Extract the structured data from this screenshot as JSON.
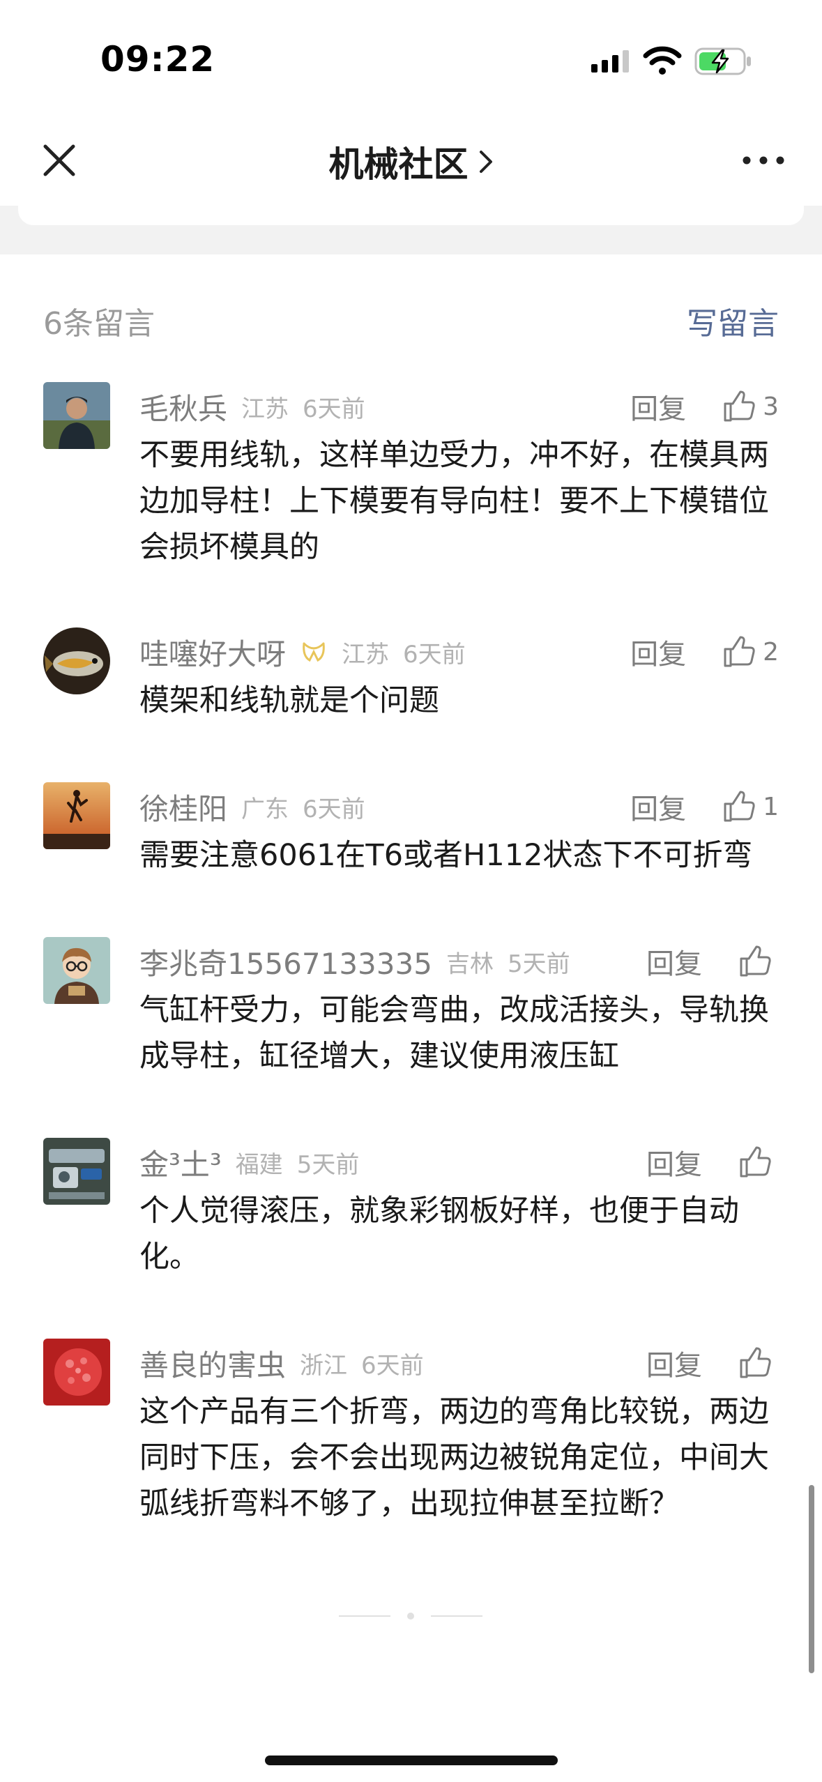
{
  "status_bar": {
    "time": "09:22",
    "battery_color": "#4cd964"
  },
  "nav": {
    "title": "机械社区",
    "chevron": "›"
  },
  "comments_header": {
    "count_label": "6条留言",
    "write_label": "写留言",
    "link_color": "#576b95"
  },
  "comments": [
    {
      "name": "毛秋兵",
      "location": "江苏",
      "time": "6天前",
      "reply": "回复",
      "likes": "3",
      "text": "不要用线轨，这样单边受力，冲不好，在模具两边加导柱！上下模要有导向柱！要不上下模错位会损坏模具的",
      "avatar_icon": "person-photo"
    },
    {
      "name": "哇噻好大呀",
      "location": "江苏",
      "time": "6天前",
      "reply": "回复",
      "likes": "2",
      "text": "模架和线轨就是个问题",
      "avatar_icon": "fish-photo",
      "badge_icon": "gold-ribbon-icon"
    },
    {
      "name": "徐桂阳",
      "location": "广东",
      "time": "6天前",
      "reply": "回复",
      "likes": "1",
      "text": "需要注意6061在T6或者H112状态下不可折弯",
      "avatar_icon": "sunset-jump-photo"
    },
    {
      "name": "李兆奇15567133335",
      "location": "吉林",
      "time": "5天前",
      "reply": "回复",
      "likes": "",
      "text": "气缸杆受力，可能会弯曲，改成活接头，导轨换成导柱，缸径增大，建议使用液压缸",
      "avatar_icon": "cartoon-avatar"
    },
    {
      "name": "金³土³",
      "location": "福建",
      "time": "5天前",
      "reply": "回复",
      "likes": "",
      "text": "个人觉得滚压，就象彩钢板好样，也便于自动化。",
      "avatar_icon": "machinery-photo"
    },
    {
      "name": "善良的害虫",
      "location": "浙江",
      "time": "6天前",
      "reply": "回复",
      "likes": "",
      "text": "这个产品有三个折弯，两边的弯角比较锐，两边同时下压，会不会出现两边被锐角定位，中间大弧线折弯料不够了，出现拉伸甚至拉断？",
      "avatar_icon": "red-fruit-photo"
    }
  ]
}
